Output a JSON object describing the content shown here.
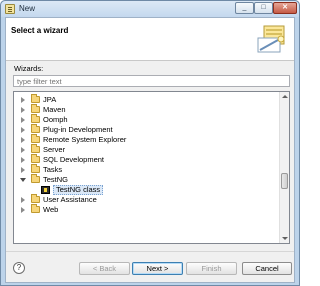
{
  "window": {
    "title": "New"
  },
  "header": {
    "title": "Select a wizard",
    "banner_icon": "wizard-banner-icon"
  },
  "wizards": {
    "label": "Wizards:"
  },
  "filter": {
    "placeholder": "type filter text",
    "value": ""
  },
  "tree": {
    "items": [
      {
        "label": "JPA",
        "expanded": false
      },
      {
        "label": "Maven",
        "expanded": false
      },
      {
        "label": "Oomph",
        "expanded": false
      },
      {
        "label": "Plug-in Development",
        "expanded": false
      },
      {
        "label": "Remote System Explorer",
        "expanded": false
      },
      {
        "label": "Server",
        "expanded": false
      },
      {
        "label": "SQL Development",
        "expanded": false
      },
      {
        "label": "Tasks",
        "expanded": false
      },
      {
        "label": "TestNG",
        "expanded": true
      },
      {
        "label": "TestNG class",
        "child": true,
        "selected": true
      },
      {
        "label": "User Assistance",
        "expanded": false
      },
      {
        "label": "Web",
        "expanded": false
      }
    ]
  },
  "buttons": {
    "back": "< Back",
    "next": "Next >",
    "finish": "Finish",
    "cancel": "Cancel",
    "help": "?"
  },
  "colors": {
    "selection": "#dbe8f7",
    "folder": "#f6d57a",
    "titlebar": "#c4d8ee"
  }
}
